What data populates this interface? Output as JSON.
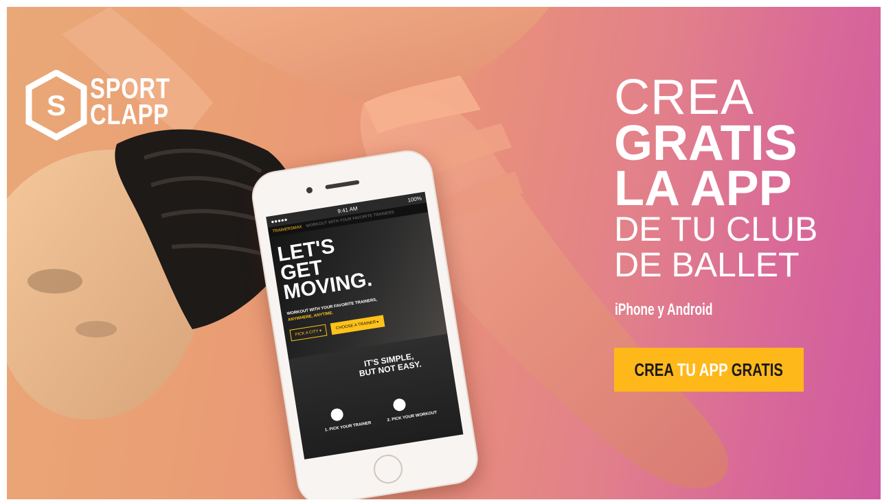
{
  "brand": {
    "name_line1": "SPORT",
    "name_line2": "CLAPP",
    "logo_letter": "S"
  },
  "headline": {
    "line1": "CREA",
    "line2": "GRATIS",
    "line3": "LA APP",
    "line4": "DE TU CLUB",
    "line5": "DE BALLET"
  },
  "subline": "iPhone y Android",
  "cta": {
    "part1": "CREA",
    "part2": " TU APP ",
    "part3": "GRATIS"
  },
  "phone_screen": {
    "time": "9:41 AM",
    "battery": "100%",
    "carrier": "●●●●● ",
    "brand": "TRAINERSMAX",
    "nav_sub": "WORKOUT WITH YOUR FAVORITE TRAINERS",
    "hero_l1": "LET'S",
    "hero_l2": "GET",
    "hero_l3": "MOVING.",
    "tagline": "WORKOUT WITH YOUR FAVORITE TRAINERS,",
    "tagline2": "ANYWHERE, ANYTIME.",
    "btn_city": "PICK A CITY ▾",
    "btn_trainer": "CHOOSE A TRAINER ▸",
    "section_title_1": "IT'S SIMPLE,",
    "section_title_2": "BUT NOT EASY.",
    "step1": "1. PICK YOUR TRAINER",
    "step2": "2. PICK YOUR WORKOUT"
  },
  "colors": {
    "accent": "#ffb81a",
    "gradient_end": "#cf5aa0",
    "gradient_start": "#e9a877"
  }
}
